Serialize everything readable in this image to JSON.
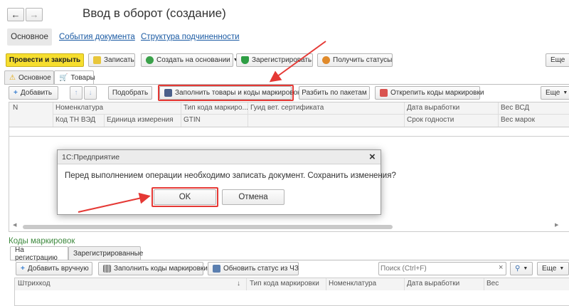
{
  "window": {
    "title": "Ввод в оборот (создание)"
  },
  "doc_tabs": {
    "main": "Основное",
    "events": "События документа",
    "structure": "Структура подчиненности"
  },
  "toolbar": {
    "post_close": "Провести и закрыть",
    "write": "Записать",
    "create_based": "Создать на основании",
    "register": "Зарегистрировать",
    "get_statuses": "Получить статусы",
    "more": "Еще"
  },
  "inner_tabs": {
    "main": "Основное",
    "goods": "Товары"
  },
  "goods_toolbar": {
    "add": "Добавить",
    "pick": "Подобрать",
    "fill_goods": "Заполнить товары и коды маркировок",
    "split": "Разбить по пакетам",
    "unbind": "Открепить коды маркировки",
    "more": "Еще"
  },
  "goods_table": {
    "row1": [
      "N",
      "Номенклатура",
      "Тип кода маркиро...",
      "Гуид вет. сертификата",
      "Дата выработки",
      "Вес ВСД"
    ],
    "row2": [
      "Код ТН ВЭД",
      "Единица измерения",
      "GTIN",
      "Срок годности",
      "Вес марок"
    ]
  },
  "dialog": {
    "title": "1С:Предприятие",
    "message": "Перед выполнением операции необходимо записать документ. Сохранить изменения?",
    "ok": "OK",
    "cancel": "Отмена"
  },
  "codes": {
    "title": "Коды маркировок",
    "tab_reg": "На регистрацию",
    "tab_registered": "Зарегистрированные",
    "add_manual": "Добавить вручную",
    "fill_codes": "Заполнить коды маркировки",
    "update_status": "Обновить статус из ЧЗ",
    "search_placeholder": "Поиск (Ctrl+F)",
    "more": "Еще",
    "columns": [
      "Штрихкод",
      "Тип кода маркировки",
      "Номенклатура",
      "Дата выработки",
      "Вес"
    ]
  }
}
